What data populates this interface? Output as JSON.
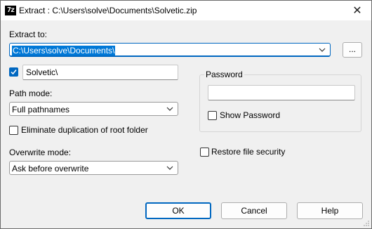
{
  "window": {
    "title": "Extract : C:\\Users\\solve\\Documents\\Solvetic.zip",
    "icon_text": "7z",
    "close_label": "✕"
  },
  "extract_to": {
    "label": "Extract to:",
    "path": "C:\\Users\\solve\\Documents\\",
    "browse_label": "..."
  },
  "subfolder": {
    "checked": true,
    "value": "Solvetic\\"
  },
  "path_mode": {
    "label": "Path mode:",
    "selected": "Full pathnames"
  },
  "eliminate_dup": {
    "label": "Eliminate duplication of root folder",
    "checked": false
  },
  "overwrite_mode": {
    "label": "Overwrite mode:",
    "selected": "Ask before overwrite"
  },
  "password": {
    "group_label": "Password",
    "value": "",
    "show_label": "Show Password",
    "show_checked": false
  },
  "restore_security": {
    "label": "Restore file security",
    "checked": false
  },
  "buttons": {
    "ok": "OK",
    "cancel": "Cancel",
    "help": "Help"
  },
  "colors": {
    "accent": "#0067c0",
    "selection": "#0078d7"
  }
}
